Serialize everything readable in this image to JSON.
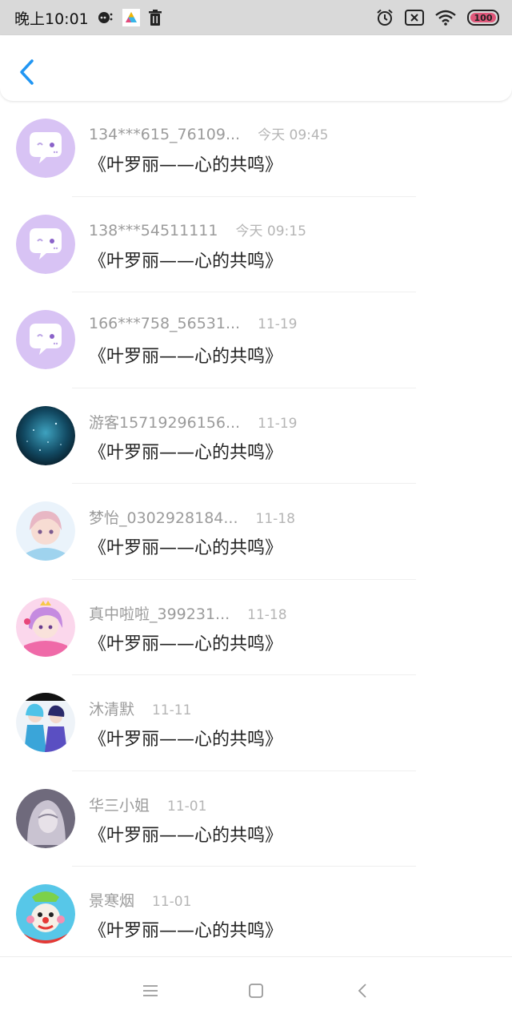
{
  "status_bar": {
    "time": "晚上10:01",
    "battery_level": 100,
    "battery_label": "100",
    "icons": [
      "chat-notification-icon",
      "app-logo-icon",
      "trash-icon",
      "alarm-icon",
      "sim-off-icon",
      "wifi-icon",
      "battery-icon"
    ]
  },
  "header": {
    "back_icon": "chevron-left-icon",
    "accent_color": "#2196f3"
  },
  "comments": [
    {
      "name": "134***615_76109...",
      "time": "今天 09:45",
      "title": "《叶罗丽——心的共鸣》",
      "avatar": "default-chat-avatar"
    },
    {
      "name": "138***54511111",
      "time": "今天 09:15",
      "title": "《叶罗丽——心的共鸣》",
      "avatar": "default-chat-avatar"
    },
    {
      "name": "166***758_56531...",
      "time": "11-19",
      "title": "《叶罗丽——心的共鸣》",
      "avatar": "default-chat-avatar"
    },
    {
      "name": "游客15719296156...",
      "time": "11-19",
      "title": "《叶罗丽——心的共鸣》",
      "avatar": "starry-sky-avatar"
    },
    {
      "name": "梦怡_0302928184...",
      "time": "11-18",
      "title": "《叶罗丽——心的共鸣》",
      "avatar": "anime-girl-avatar"
    },
    {
      "name": "真中啦啦_399231...",
      "time": "11-18",
      "title": "《叶罗丽——心的共鸣》",
      "avatar": "anime-princess-avatar"
    },
    {
      "name": "沐清默",
      "time": "11-11",
      "title": "《叶罗丽——心的共鸣》",
      "avatar": "cosplay-avatar"
    },
    {
      "name": "华三小姐",
      "time": "11-01",
      "title": "《叶罗丽——心的共鸣》",
      "avatar": "hooded-figure-avatar"
    },
    {
      "name": "景寒烟",
      "time": "11-01",
      "title": "《叶罗丽——心的共鸣》",
      "avatar": "clown-avatar"
    }
  ],
  "nav_bar": {
    "icons": [
      "menu-icon",
      "home-icon",
      "back-icon"
    ]
  }
}
